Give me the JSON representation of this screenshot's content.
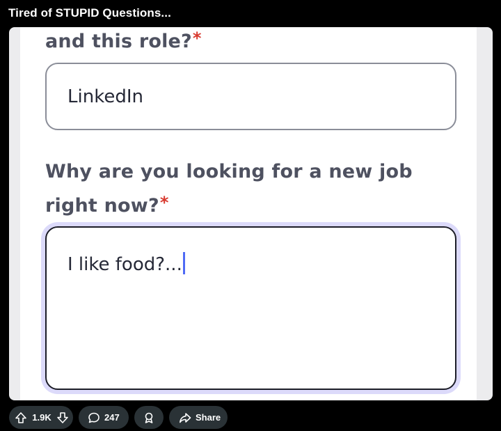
{
  "post": {
    "title": "Tired of STUPID Questions..."
  },
  "form": {
    "question_source": "and this role?",
    "question_source_required": "*",
    "answer_source": "LinkedIn",
    "question_reason": "Why are you looking for a new job right now?",
    "question_reason_required": "*",
    "answer_reason": "I like food?..."
  },
  "actions": {
    "upvote_count": "1.9K",
    "comment_count": "247",
    "share_label": "Share"
  },
  "icons": [
    "upvote-icon",
    "downvote-icon",
    "comment-icon",
    "award-icon",
    "share-icon"
  ],
  "colors": {
    "background": "#000000",
    "pill": "#2a3236",
    "label_text": "#4e5160",
    "required_asterisk": "#d83a2f",
    "focus_ring": "#dcdafa",
    "caret": "#4f6bf5"
  }
}
